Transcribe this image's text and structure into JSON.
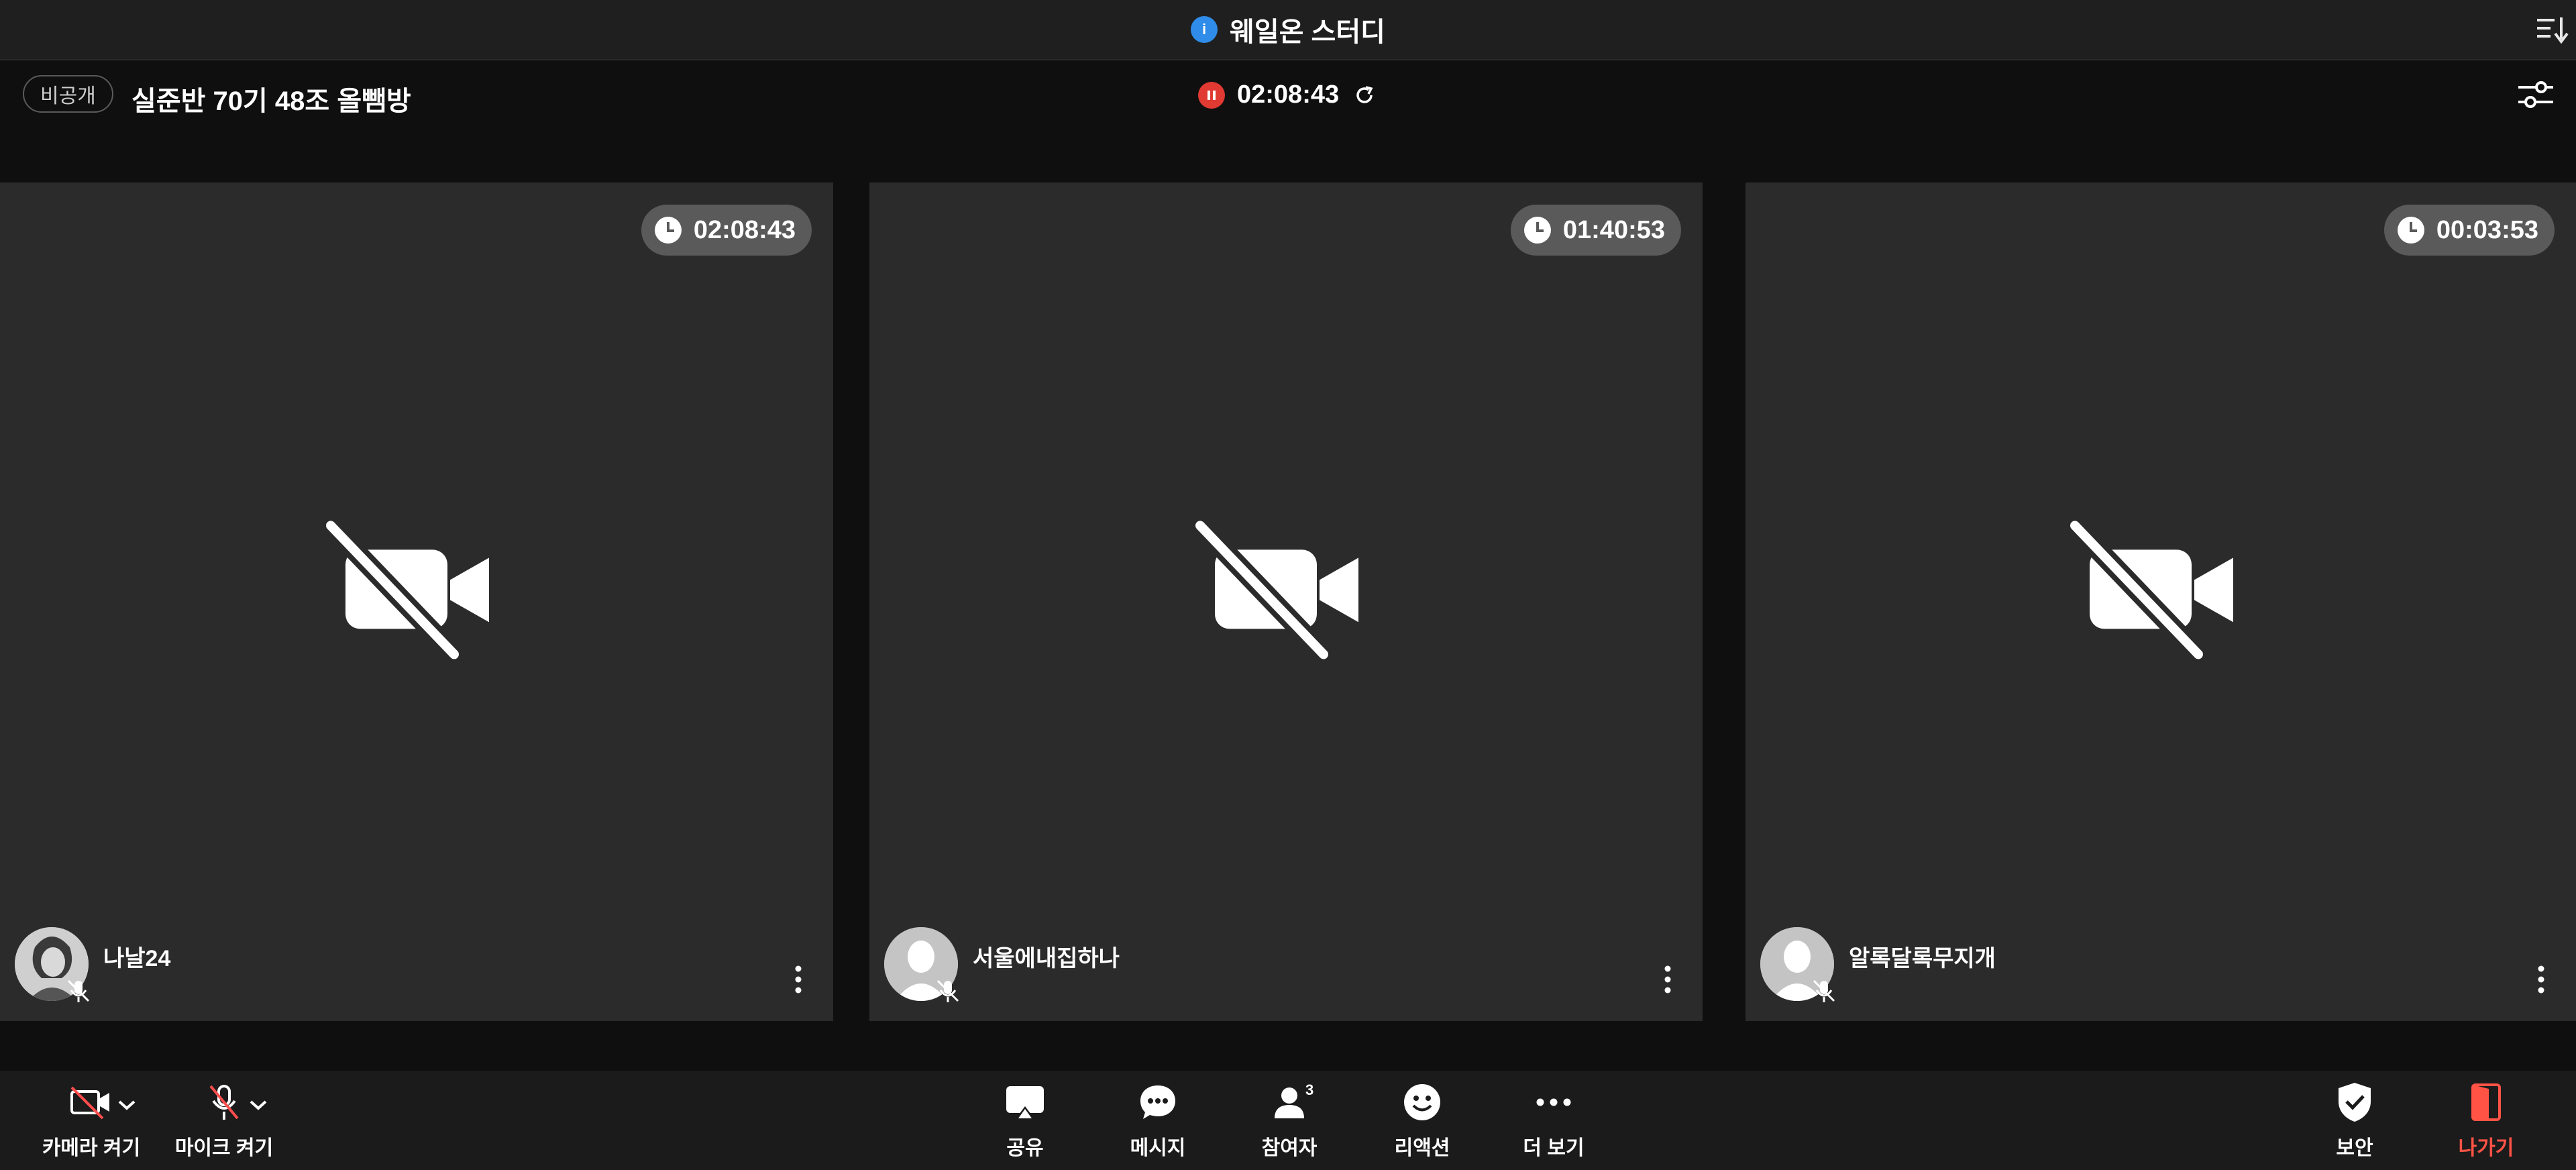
{
  "top_bar": {
    "title": "웨일온 스터디",
    "info_icon": "i"
  },
  "header": {
    "visibility_badge": "비공개",
    "room_title": "실준반 70기 48조 올뺌방",
    "recording_time": "02:08:43"
  },
  "tiles": [
    {
      "timer": "02:08:43",
      "name": "나날24"
    },
    {
      "timer": "01:40:53",
      "name": "서울에내집하나"
    },
    {
      "timer": "00:03:53",
      "name": "알록달록무지개"
    }
  ],
  "toolbar": {
    "camera_label": "카메라 켜기",
    "mic_label": "마이크 켜기",
    "share_label": "공유",
    "message_label": "메시지",
    "participants_label": "참여자",
    "participants_count": "3",
    "reaction_label": "리액션",
    "more_label": "더 보기",
    "security_label": "보안",
    "leave_label": "나가기"
  },
  "colors": {
    "accent_blue": "#2f8ce8",
    "record_red": "#e03a33",
    "leave_red": "#ff5346"
  }
}
